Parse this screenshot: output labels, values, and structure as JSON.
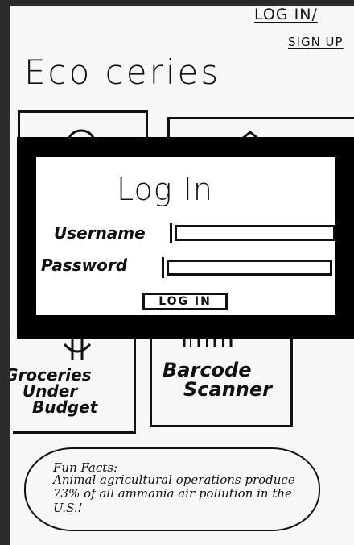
{
  "header": {
    "login_link": "LOG IN/",
    "signup_link": "SIGN UP"
  },
  "app": {
    "title": "Eco ceries"
  },
  "cards": {
    "groceries_line1": "Groceries",
    "groceries_line2": "Under",
    "groceries_line3": "Budget",
    "barcode_line1": "Barcode",
    "barcode_line2": "Scanner"
  },
  "icons": {
    "card_top_left": "person-icon",
    "card_top_right": "house-icon",
    "groceries": "dollar-icon",
    "barcode": "barcode-icon"
  },
  "modal": {
    "title": "Log In",
    "username_label": "Username",
    "username_value": "",
    "password_label": "Password",
    "password_value": "",
    "login_button": "LOG IN"
  },
  "fun_facts": {
    "title": "Fun Facts:",
    "text": "Animal agricultural operations produce 73% of all ammania air pollution in the U.S.!"
  }
}
